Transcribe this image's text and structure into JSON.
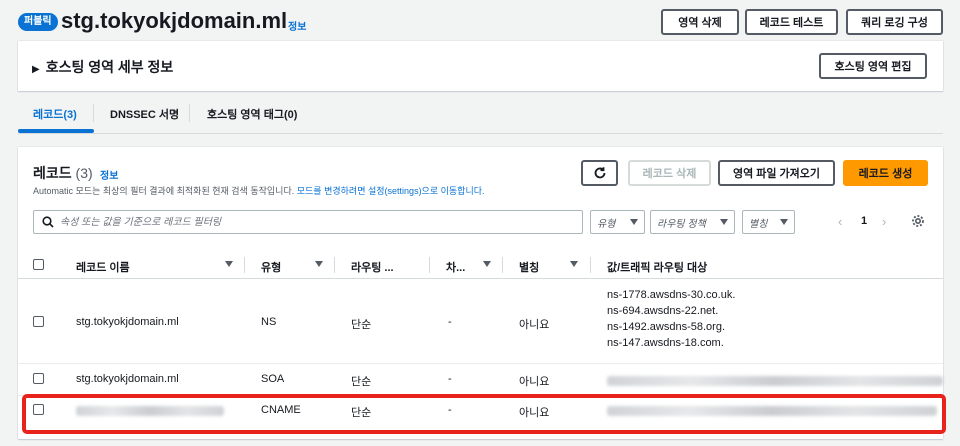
{
  "header": {
    "badge": "퍼블릭",
    "title": "stg.tokyokjdomain.ml",
    "info": "정보",
    "buttons": {
      "delete_zone": "영역 삭제",
      "test_record": "레코드 테스트",
      "query_logging": "쿼리 로깅 구성"
    }
  },
  "hosting_details": {
    "title": "호스팅 영역 세부 정보",
    "edit_button": "호스팅 영역 편집"
  },
  "tabs": [
    {
      "label": "레코드(3)",
      "active": true
    },
    {
      "label": "DNSSEC 서명",
      "active": false
    },
    {
      "label": "호스팅 영역 태그(0)",
      "active": false
    }
  ],
  "records": {
    "title": "레코드",
    "count": "(3)",
    "info": "정보",
    "desc_prefix": "Automatic 모드는 최상의 필터 결과에 최적화된 현재 검색 동작입니다. ",
    "desc_link": "모드를 변경하려면 설정(settings)으로 이동합니다.",
    "buttons": {
      "delete": "레코드 삭제",
      "import": "영역 파일 가져오기",
      "create": "레코드 생성"
    },
    "search_placeholder": "속성 또는 값을 기준으로 레코드 필터링",
    "filters": {
      "type": "유형",
      "routing": "라우팅 정책",
      "alias": "별칭"
    },
    "page": "1",
    "columns": {
      "name": "레코드 이름",
      "type": "유형",
      "routing": "라우팅 ...",
      "diff": "차...",
      "alias": "별칭",
      "value": "값/트래픽 라우팅 대상"
    },
    "rows": [
      {
        "name": "stg.tokyokjdomain.ml",
        "type": "NS",
        "routing": "단순",
        "diff": "-",
        "alias": "아니요",
        "values": [
          "ns-1778.awsdns-30.co.uk.",
          "ns-694.awsdns-22.net.",
          "ns-1492.awsdns-58.org.",
          "ns-147.awsdns-18.com."
        ]
      },
      {
        "name": "stg.tokyokjdomain.ml",
        "type": "SOA",
        "routing": "단순",
        "diff": "-",
        "alias": "아니요"
      },
      {
        "type": "CNAME",
        "routing": "단순",
        "diff": "-",
        "alias": "아니요"
      }
    ]
  },
  "colors": {
    "accent": "#0972d3",
    "primary_button": "#ff9900",
    "highlight": "#e8231b"
  }
}
